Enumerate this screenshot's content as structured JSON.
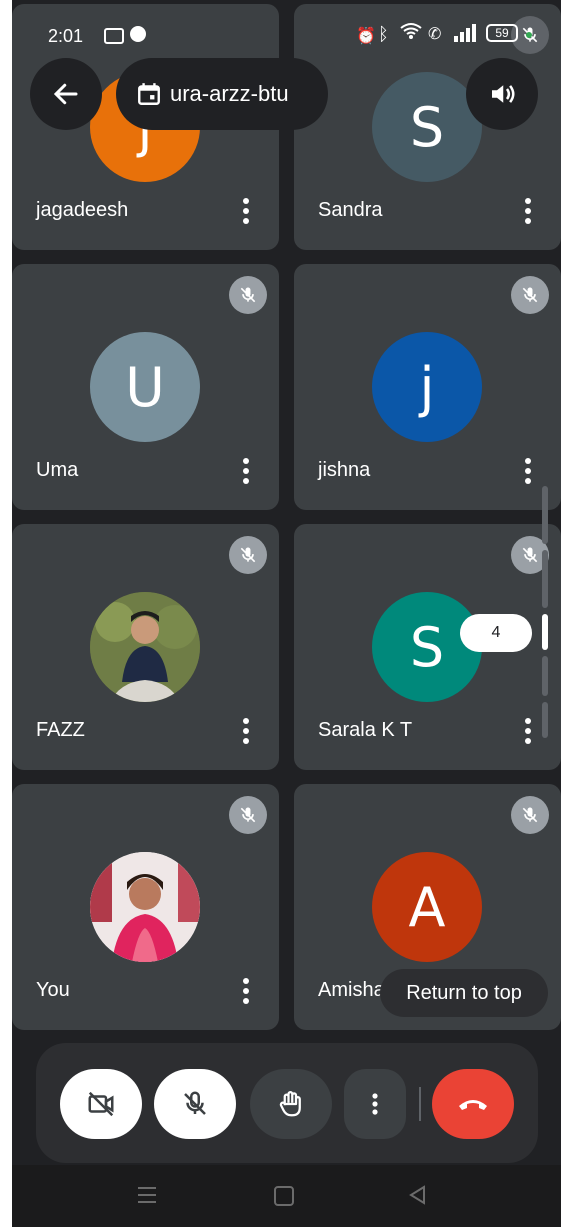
{
  "status_bar": {
    "time": "2:01",
    "battery": "59"
  },
  "meeting": {
    "code": "ura-arzz-btu"
  },
  "participants": [
    {
      "name": "jagadeesh",
      "initial": "j",
      "avatar_color": "#e8710a"
    },
    {
      "name": "Sandra",
      "initial": "S",
      "avatar_color": "#455a64"
    },
    {
      "name": "Uma",
      "initial": "U",
      "avatar_color": "#78909c"
    },
    {
      "name": "jishna",
      "initial": "j",
      "avatar_color": "#0b57a8"
    },
    {
      "name": "FAZZ",
      "initial": "",
      "avatar_color": "#5d6b3a"
    },
    {
      "name": "Sarala K T",
      "initial": "S",
      "avatar_color": "#00897b"
    },
    {
      "name": "You",
      "initial": "",
      "avatar_color": "#c2185b"
    },
    {
      "name": "Amisha",
      "initial": "A",
      "avatar_color": "#bf360c"
    }
  ],
  "scroll_indicator": {
    "page": "4"
  },
  "return_to_top_label": "Return to top",
  "colors": {
    "background": "#202124",
    "tile": "#3c4043",
    "end_call": "#ea4335"
  }
}
